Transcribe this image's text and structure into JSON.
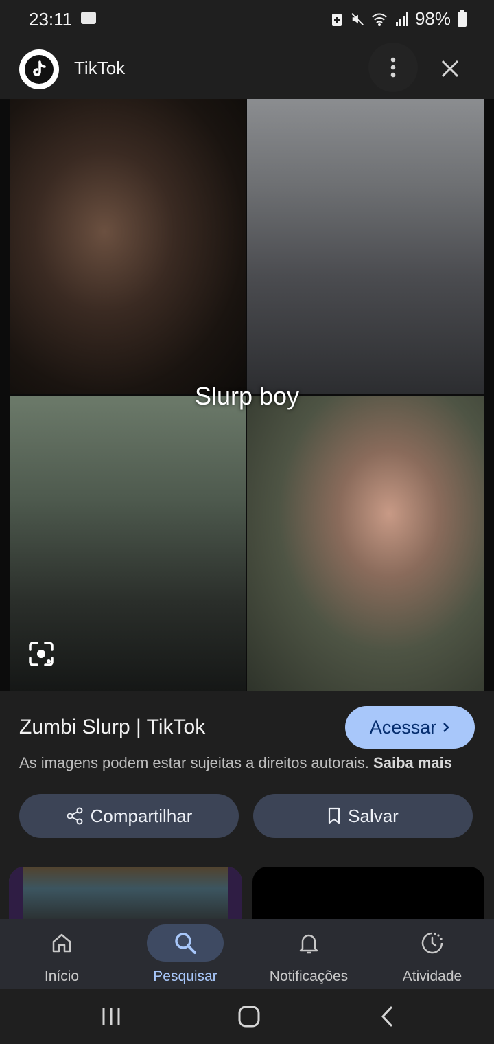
{
  "status_bar": {
    "time": "23:11",
    "battery": "98%"
  },
  "header": {
    "title": "TikTok",
    "logo_icon": "tiktok-logo-icon",
    "more_icon": "more-vert-icon",
    "close_icon": "close-icon"
  },
  "image": {
    "overlay_text": "Slurp boy",
    "lens_icon": "google-lens-icon"
  },
  "info": {
    "source_title": "Zumbi Slurp | TikTok",
    "visit_label": "Acessar",
    "copyright_text": "As imagens podem estar sujeitas a direitos autorais.",
    "learn_more": "Saiba mais",
    "share_label": "Compartilhar",
    "save_label": "Salvar"
  },
  "bottom_nav": {
    "items": [
      {
        "label": "Início",
        "icon": "home-icon"
      },
      {
        "label": "Pesquisar",
        "icon": "search-icon",
        "active": true
      },
      {
        "label": "Notificações",
        "icon": "bell-icon"
      },
      {
        "label": "Atividade",
        "icon": "activity-icon"
      }
    ]
  },
  "system_nav": {
    "recents_icon": "recents-icon",
    "home_icon": "home-circle-icon",
    "back_icon": "back-icon"
  },
  "colors": {
    "background": "#1f1f1f",
    "accent": "#a8c7fa",
    "button_bg": "#3c4456",
    "nav_bg": "#2a2c32"
  }
}
